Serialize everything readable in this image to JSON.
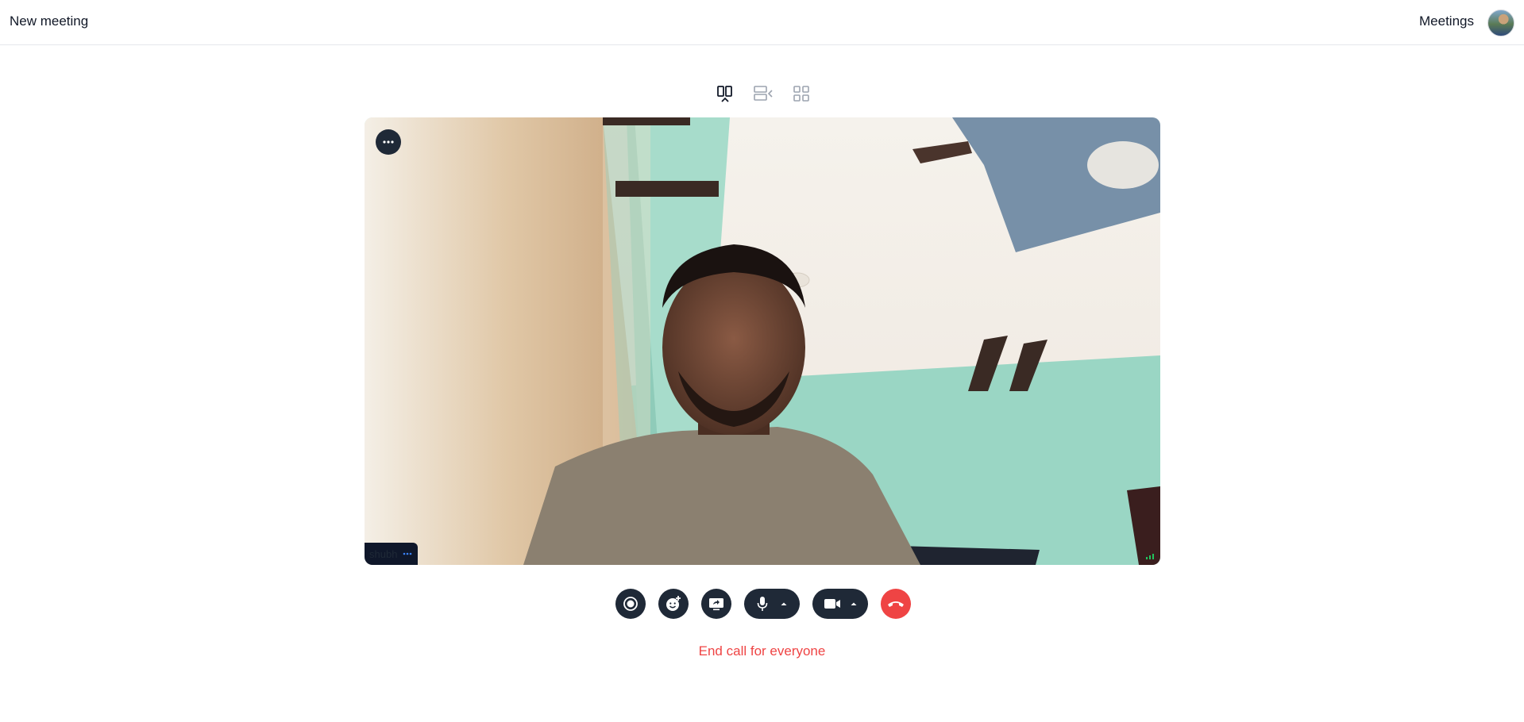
{
  "header": {
    "title": "New meeting",
    "meetings_label": "Meetings",
    "avatar_icon": "user-avatar"
  },
  "layout_switcher": {
    "options": [
      "speaker-view-icon",
      "sidebar-view-icon",
      "grid-view-icon"
    ],
    "selected": "speaker-view-icon"
  },
  "video_tile": {
    "participant_name": "shubh",
    "more_icon": "more-horizontal-icon",
    "signal_icon": "signal-strength-icon"
  },
  "controls": {
    "record_icon": "record-icon",
    "reactions_icon": "emoji-add-icon",
    "screenshare_icon": "screen-share-icon",
    "mic_icon": "microphone-icon",
    "camera_icon": "video-camera-icon",
    "hangup_icon": "phone-hangup-icon",
    "end_for_everyone_label": "End call for everyone"
  },
  "colors": {
    "accent_danger": "#ef4444",
    "control_bg": "#1f2937",
    "border": "#e5e7eb"
  }
}
